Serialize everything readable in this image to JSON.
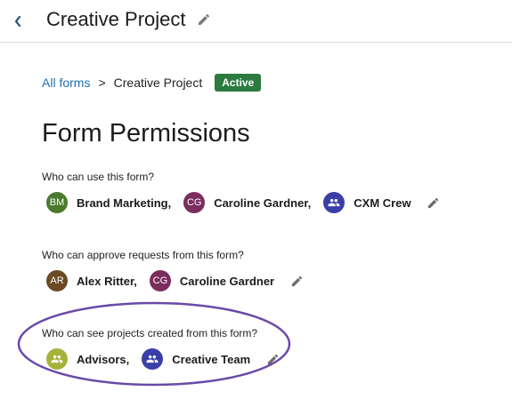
{
  "header": {
    "title": "Creative Project"
  },
  "breadcrumb": {
    "root": "All forms",
    "separator": ">",
    "current": "Creative Project",
    "status": "Active"
  },
  "heading": "Form Permissions",
  "sections": [
    {
      "question": "Who can use this form?",
      "members": [
        {
          "initials": "BM",
          "label": "Brand Marketing,",
          "color": "#4a7a2e",
          "icon": ""
        },
        {
          "initials": "CG",
          "label": "Caroline Gardner,",
          "color": "#7b2d5e",
          "icon": ""
        },
        {
          "initials": "",
          "label": "CXM Crew",
          "color": "#3a3fa8",
          "icon": "group-icon"
        }
      ]
    },
    {
      "question": "Who can approve requests from this form?",
      "members": [
        {
          "initials": "AR",
          "label": "Alex Ritter,",
          "color": "#6b4a24",
          "icon": ""
        },
        {
          "initials": "CG",
          "label": "Caroline Gardner",
          "color": "#7b2d5e",
          "icon": ""
        }
      ]
    },
    {
      "question": "Who can see projects created from this form?",
      "members": [
        {
          "initials": "",
          "label": "Advisors,",
          "color": "#a8b23a",
          "icon": "group-icon"
        },
        {
          "initials": "",
          "label": "Creative Team",
          "color": "#3a3fa8",
          "icon": "group-icon"
        }
      ]
    }
  ],
  "colors": {
    "link": "#1f6fb2",
    "status_badge": "#2b7a3f",
    "highlight": "#6a4aa8",
    "edit_icon": "#6b6b6b"
  }
}
